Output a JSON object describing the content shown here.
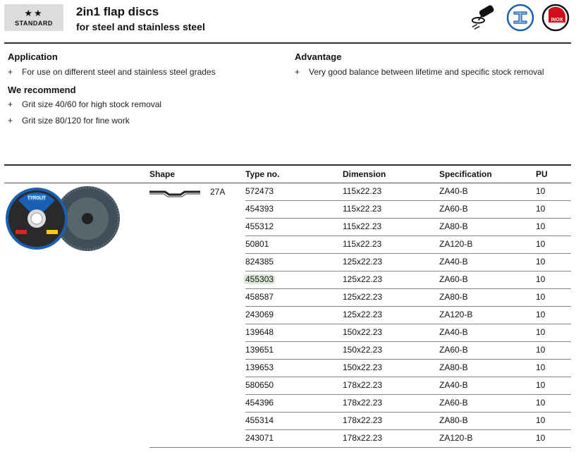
{
  "header": {
    "badge_stars": "★★",
    "badge_label": "STANDARD",
    "title": "2in1 flap discs",
    "subtitle": "for steel and stainless steel",
    "icons": [
      "angle-grinder-icon",
      "steel-profile-icon",
      "inox-icon"
    ],
    "inox_text": "INOX"
  },
  "application": {
    "heading": "Application",
    "items": [
      "For use on different steel and stainless steel grades"
    ]
  },
  "advantage": {
    "heading": "Advantage",
    "items": [
      "Very good balance between lifetime and specific stock removal"
    ]
  },
  "recommend": {
    "heading": "We recommend",
    "items": [
      "Grit size 40/60 for high stock removal",
      "Grit size 80/120 for fine work"
    ]
  },
  "bullet": "+",
  "table": {
    "headers": {
      "shape": "Shape",
      "type": "Type no.",
      "dimension": "Dimension",
      "specification": "Specification",
      "pu": "PU"
    },
    "shape_code": "27A",
    "highlight_color": "#dbe8d7",
    "rows": [
      {
        "type": "572473",
        "dim": "115x22.23",
        "spec": "ZA40-B",
        "pu": "10"
      },
      {
        "type": "454393",
        "dim": "115x22.23",
        "spec": "ZA60-B",
        "pu": "10"
      },
      {
        "type": "455312",
        "dim": "115x22.23",
        "spec": "ZA80-B",
        "pu": "10"
      },
      {
        "type": "50801",
        "dim": "115x22.23",
        "spec": "ZA120-B",
        "pu": "10"
      },
      {
        "type": "824385",
        "dim": "125x22.23",
        "spec": "ZA40-B",
        "pu": "10"
      },
      {
        "type": "455303",
        "dim": "125x22.23",
        "spec": "ZA60-B",
        "pu": "10"
      },
      {
        "type": "458587",
        "dim": "125x22.23",
        "spec": "ZA80-B",
        "pu": "10"
      },
      {
        "type": "243069",
        "dim": "125x22.23",
        "spec": "ZA120-B",
        "pu": "10"
      },
      {
        "type": "139648",
        "dim": "150x22.23",
        "spec": "ZA40-B",
        "pu": "10"
      },
      {
        "type": "139651",
        "dim": "150x22.23",
        "spec": "ZA60-B",
        "pu": "10"
      },
      {
        "type": "139653",
        "dim": "150x22.23",
        "spec": "ZA80-B",
        "pu": "10"
      },
      {
        "type": "580650",
        "dim": "178x22.23",
        "spec": "ZA40-B",
        "pu": "10"
      },
      {
        "type": "454396",
        "dim": "178x22.23",
        "spec": "ZA60-B",
        "pu": "10"
      },
      {
        "type": "455314",
        "dim": "178x22.23",
        "spec": "ZA80-B",
        "pu": "10"
      },
      {
        "type": "243071",
        "dim": "178x22.23",
        "spec": "ZA120-B",
        "pu": "10"
      }
    ],
    "highlighted_row": 5
  },
  "product_image": "flap-disc-product-photo",
  "disc_logo": "TYROLIT"
}
